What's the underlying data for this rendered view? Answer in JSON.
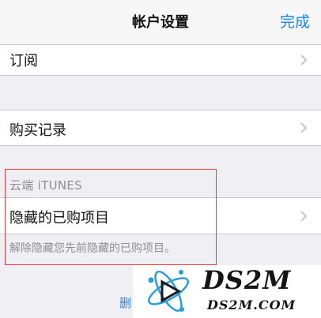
{
  "navbar": {
    "title": "帐户设置",
    "done_label": "完成"
  },
  "rows": {
    "subscriptions_label": "订阅",
    "purchase_history_label": "购买记录"
  },
  "itunes_section": {
    "header": "云端 iTUNES",
    "hidden_purchases_label": "隐藏的已购项目",
    "footer": "解除隐藏您先前隐藏的已购项目。"
  },
  "bottom": {
    "partial_link": "删"
  },
  "watermark": {
    "title": "DS2M",
    "subtitle": "DS2M.COM"
  },
  "colors": {
    "accent": "#1a82fb",
    "highlight": "#e43b3b",
    "background": "#efeff4"
  },
  "icons": {
    "row_chevron": "chevron-right-icon",
    "logo": "atom-play-logo-icon"
  }
}
